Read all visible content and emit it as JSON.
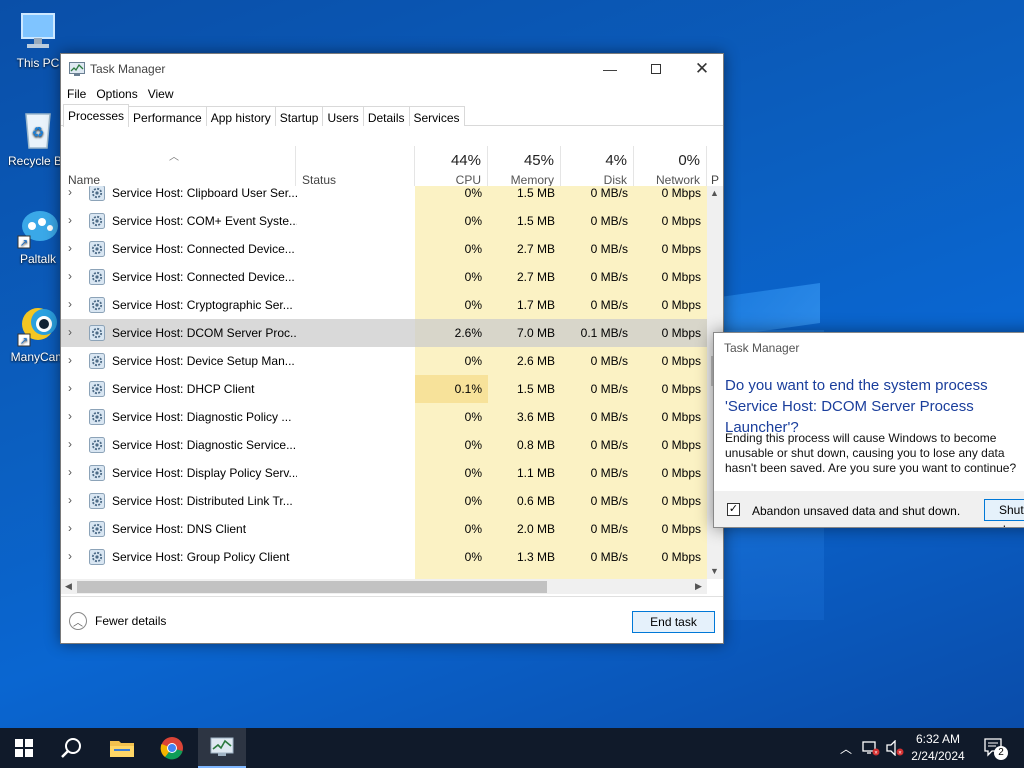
{
  "desktop": {
    "icons": [
      {
        "label": "This PC",
        "icon": "computer-icon"
      },
      {
        "label": "Recycle Bin",
        "icon": "recycle-bin-icon"
      },
      {
        "label": "Paltalk",
        "icon": "paltalk-icon"
      },
      {
        "label": "ManyCam",
        "icon": "manycam-icon"
      }
    ]
  },
  "task_manager": {
    "title": "Task Manager",
    "menu": [
      "File",
      "Options",
      "View"
    ],
    "tabs": [
      "Processes",
      "Performance",
      "App history",
      "Startup",
      "Users",
      "Details",
      "Services"
    ],
    "active_tab": "Processes",
    "columns": {
      "name": "Name",
      "status": "Status",
      "cpu": {
        "pct": "44%",
        "label": "CPU"
      },
      "memory": {
        "pct": "45%",
        "label": "Memory"
      },
      "disk": {
        "pct": "4%",
        "label": "Disk"
      },
      "network": {
        "pct": "0%",
        "label": "Network"
      },
      "power": "P"
    },
    "rows": [
      {
        "name": "Service Host: Clipboard User Ser...",
        "cpu": "0%",
        "mem": "1.5 MB",
        "disk": "0 MB/s",
        "net": "0 Mbps"
      },
      {
        "name": "Service Host: COM+ Event Syste...",
        "cpu": "0%",
        "mem": "1.5 MB",
        "disk": "0 MB/s",
        "net": "0 Mbps"
      },
      {
        "name": "Service Host: Connected Device...",
        "cpu": "0%",
        "mem": "2.7 MB",
        "disk": "0 MB/s",
        "net": "0 Mbps"
      },
      {
        "name": "Service Host: Connected Device...",
        "cpu": "0%",
        "mem": "2.7 MB",
        "disk": "0 MB/s",
        "net": "0 Mbps"
      },
      {
        "name": "Service Host: Cryptographic Ser...",
        "cpu": "0%",
        "mem": "1.7 MB",
        "disk": "0 MB/s",
        "net": "0 Mbps"
      },
      {
        "name": "Service Host: DCOM Server Proc...",
        "cpu": "2.6%",
        "mem": "7.0 MB",
        "disk": "0.1 MB/s",
        "net": "0 Mbps",
        "selected": true
      },
      {
        "name": "Service Host: Device Setup Man...",
        "cpu": "0%",
        "mem": "2.6 MB",
        "disk": "0 MB/s",
        "net": "0 Mbps"
      },
      {
        "name": "Service Host: DHCP Client",
        "cpu": "0.1%",
        "mem": "1.5 MB",
        "disk": "0 MB/s",
        "net": "0 Mbps",
        "cpu_highlight": true
      },
      {
        "name": "Service Host: Diagnostic Policy ...",
        "cpu": "0%",
        "mem": "3.6 MB",
        "disk": "0 MB/s",
        "net": "0 Mbps"
      },
      {
        "name": "Service Host: Diagnostic Service...",
        "cpu": "0%",
        "mem": "0.8 MB",
        "disk": "0 MB/s",
        "net": "0 Mbps"
      },
      {
        "name": "Service Host: Display Policy Serv...",
        "cpu": "0%",
        "mem": "1.1 MB",
        "disk": "0 MB/s",
        "net": "0 Mbps"
      },
      {
        "name": "Service Host: Distributed Link Tr...",
        "cpu": "0%",
        "mem": "0.6 MB",
        "disk": "0 MB/s",
        "net": "0 Mbps"
      },
      {
        "name": "Service Host: DNS Client",
        "cpu": "0%",
        "mem": "2.0 MB",
        "disk": "0 MB/s",
        "net": "0 Mbps"
      },
      {
        "name": "Service Host: Group Policy Client",
        "cpu": "0%",
        "mem": "1.3 MB",
        "disk": "0 MB/s",
        "net": "0 Mbps"
      }
    ],
    "fewer_details": "Fewer details",
    "end_task": "End task"
  },
  "dialog": {
    "title": "Task Manager",
    "heading": "Do you want to end the system process 'Service Host: DCOM Server Process Launcher'?",
    "body": "Ending this process will cause Windows to become unusable or shut down, causing you to lose any data hasn't been saved. Are you sure you want to continue?",
    "checkbox_label": "Abandon unsaved data and shut down.",
    "checkbox_checked": true,
    "shutdown_button": "Shut down"
  },
  "taskbar": {
    "time": "6:32 AM",
    "date": "2/24/2024",
    "notifications_count": "2"
  }
}
